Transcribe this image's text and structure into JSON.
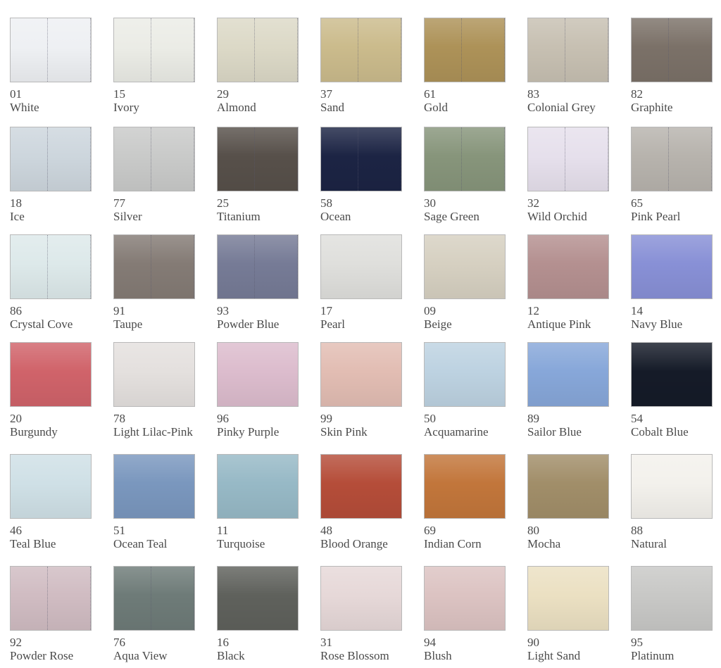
{
  "swatches": [
    {
      "code": "01",
      "name": "White",
      "color": "#eef0f3",
      "stitch": true
    },
    {
      "code": "15",
      "name": "Ivory",
      "color": "#ebece6",
      "stitch": true
    },
    {
      "code": "29",
      "name": "Almond",
      "color": "#dcd9c7",
      "stitch": true
    },
    {
      "code": "37",
      "name": "Sand",
      "color": "#cbbb8c",
      "stitch": true
    },
    {
      "code": "61",
      "name": "Gold",
      "color": "#ad9258",
      "stitch": true
    },
    {
      "code": "83",
      "name": "Colonial Grey",
      "color": "#c7c0b2",
      "stitch": true
    },
    {
      "code": "82",
      "name": "Graphite",
      "color": "#7b7168",
      "stitch": true
    },
    {
      "code": "18",
      "name": "Ice",
      "color": "#cdd6dd",
      "stitch": true
    },
    {
      "code": "77",
      "name": "Silver",
      "color": "#c9cac9",
      "stitch": true
    },
    {
      "code": "25",
      "name": "Titanium",
      "color": "#57504a",
      "stitch": true
    },
    {
      "code": "58",
      "name": "Ocean",
      "color": "#1c2444",
      "stitch": true
    },
    {
      "code": "30",
      "name": "Sage Green",
      "color": "#87957b",
      "stitch": true
    },
    {
      "code": "32",
      "name": "Wild Orchid",
      "color": "#e6e0ec",
      "stitch": true
    },
    {
      "code": "65",
      "name": "Pink Pearl",
      "color": "#b7b3ad",
      "stitch": true
    },
    {
      "code": "86",
      "name": "Crystal Cove",
      "color": "#dde9ea",
      "stitch": true
    },
    {
      "code": "91",
      "name": "Taupe",
      "color": "#847b75",
      "stitch": true
    },
    {
      "code": "93",
      "name": "Powder Blue",
      "color": "#767b96",
      "stitch": true
    },
    {
      "code": "17",
      "name": "Pearl",
      "color": "#dfdfdc",
      "stitch": false
    },
    {
      "code": "09",
      "name": "Beige",
      "color": "#d6d0c1",
      "stitch": false
    },
    {
      "code": "12",
      "name": "Antique Pink",
      "color": "#b49090",
      "stitch": false
    },
    {
      "code": "14",
      "name": "Navy Blue",
      "color": "#8890d6",
      "stitch": false
    },
    {
      "code": "20",
      "name": "Burgundy",
      "color": "#d0636a",
      "stitch": false
    },
    {
      "code": "78",
      "name": "Light Lilac-Pink",
      "color": "#e4e0de",
      "stitch": false
    },
    {
      "code": "96",
      "name": "Pinky Purple",
      "color": "#dcbccd",
      "stitch": false
    },
    {
      "code": "99",
      "name": "Skin Pink",
      "color": "#e2bdb3",
      "stitch": false
    },
    {
      "code": "50",
      "name": "Acquamarine",
      "color": "#bdd2e1",
      "stitch": false
    },
    {
      "code": "89",
      "name": "Sailor Blue",
      "color": "#87a7d9",
      "stitch": false
    },
    {
      "code": "54",
      "name": "Cobalt Blue",
      "color": "#151b28",
      "stitch": false
    },
    {
      "code": "46",
      "name": "Teal Blue",
      "color": "#cfe0e6",
      "stitch": false
    },
    {
      "code": "51",
      "name": "Ocean Teal",
      "color": "#7a97be",
      "stitch": false
    },
    {
      "code": "11",
      "name": "Turquoise",
      "color": "#97b9c6",
      "stitch": false
    },
    {
      "code": "48",
      "name": "Blood Orange",
      "color": "#b54d39",
      "stitch": false
    },
    {
      "code": "69",
      "name": "Indian Corn",
      "color": "#c2763b",
      "stitch": false
    },
    {
      "code": "80",
      "name": "Mocha",
      "color": "#a18e69",
      "stitch": false
    },
    {
      "code": "88",
      "name": "Natural",
      "color": "#f3f1ec",
      "stitch": false
    },
    {
      "code": "92",
      "name": "Powder Rose",
      "color": "#d0bcc2",
      "stitch": true
    },
    {
      "code": "76",
      "name": "Aqua View",
      "color": "#6e7b78",
      "stitch": true
    },
    {
      "code": "16",
      "name": "Black",
      "color": "#5f615c",
      "stitch": false
    },
    {
      "code": "31",
      "name": "Rose Blossom",
      "color": "#e6d8d8",
      "stitch": false
    },
    {
      "code": "94",
      "name": "Blush",
      "color": "#dcc3c2",
      "stitch": false
    },
    {
      "code": "90",
      "name": "Light Sand",
      "color": "#ebe0c2",
      "stitch": false
    },
    {
      "code": "95",
      "name": "Platinum",
      "color": "#c8c8c6",
      "stitch": false
    }
  ]
}
